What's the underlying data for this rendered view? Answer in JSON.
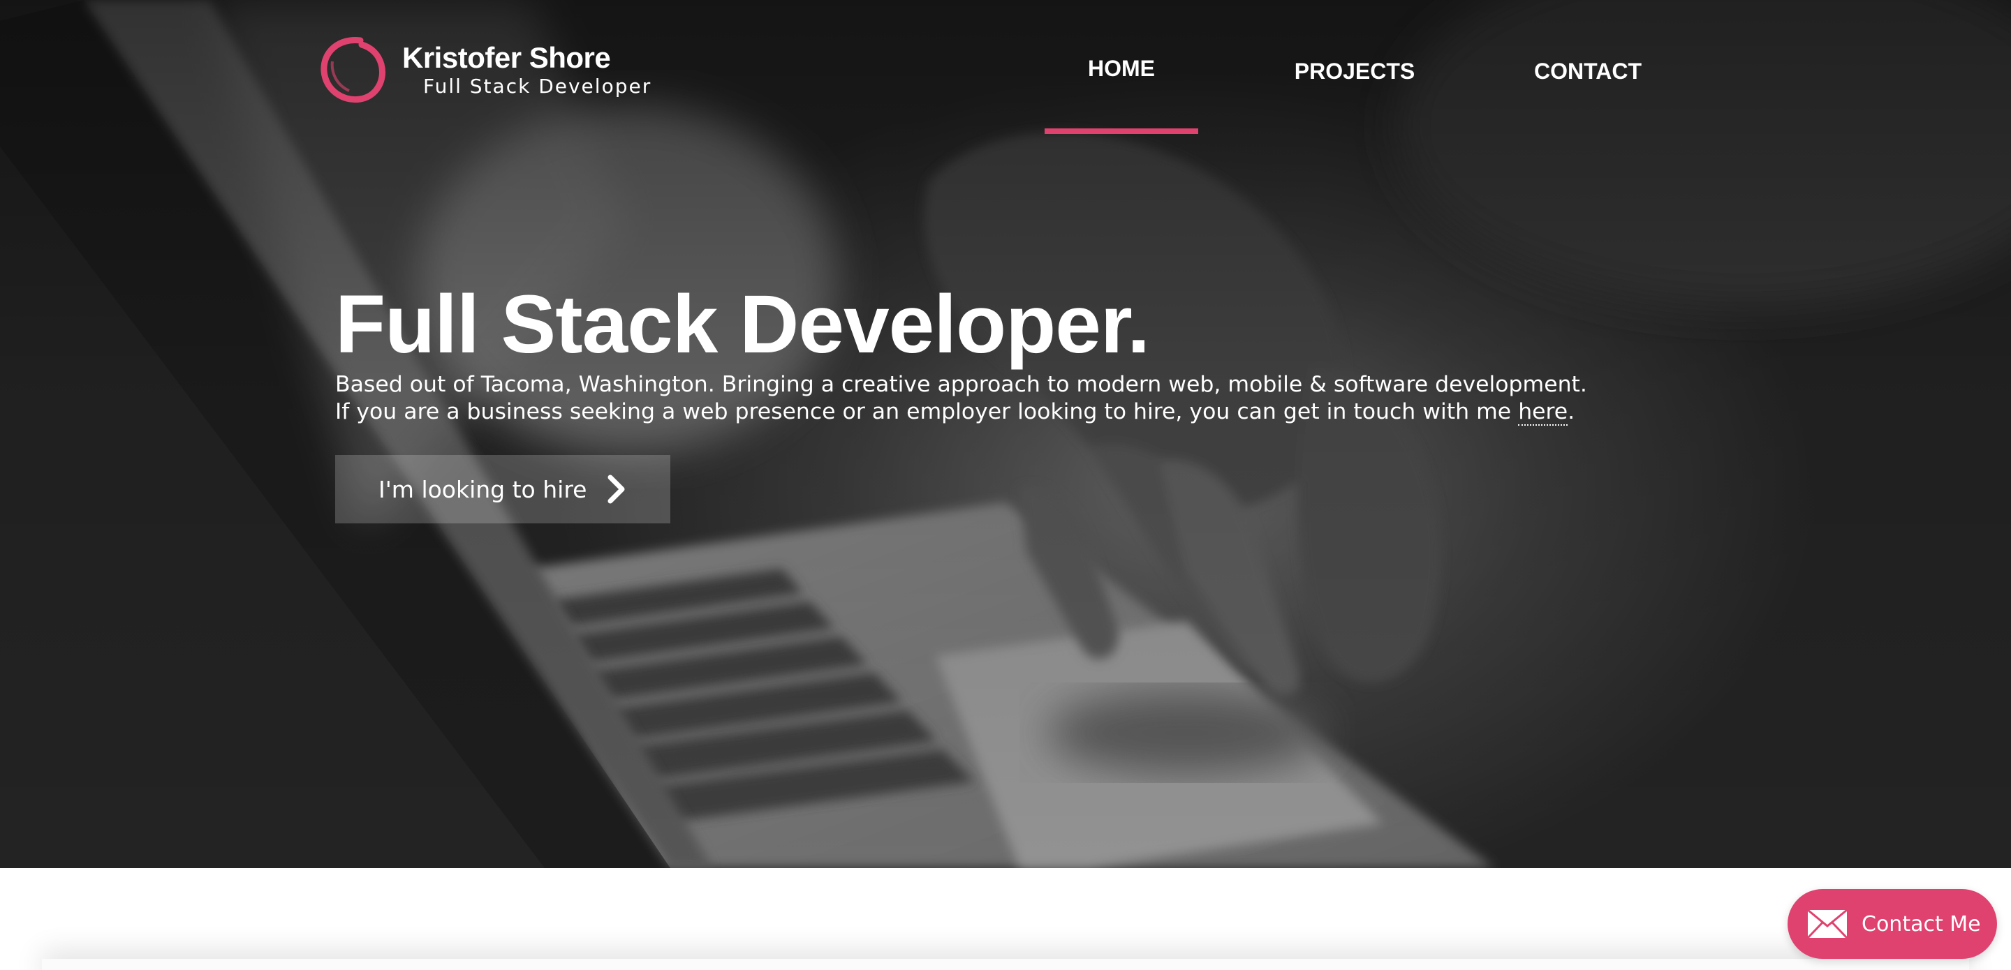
{
  "header": {
    "brand_name": "Kristofer Shore",
    "brand_role": "Full Stack Developer",
    "logo_icon": "enso-circle-icon"
  },
  "nav": {
    "items": [
      {
        "label": "HOME",
        "active": true
      },
      {
        "label": "PROJECTS",
        "active": false
      },
      {
        "label": "CONTACT",
        "active": false
      }
    ]
  },
  "hero": {
    "title": "Full Stack Developer.",
    "desc_line1": "Based out of Tacoma, Washington. Bringing a creative approach to modern web, mobile & software development.",
    "desc_line2_prefix": "If you are a business seeking a web presence or an employer looking to hire, you can get in touch with me ",
    "desc_link": "here",
    "desc_line2_suffix": ".",
    "cta_label": "I'm looking to hire",
    "cta_icon": "chevron-right-icon"
  },
  "floating_contact": {
    "label": "Contact Me",
    "icon": "envelope-icon"
  },
  "colors": {
    "accent": "#e0426f",
    "hero_overlay": "#252525",
    "text_light": "#ffffff"
  }
}
